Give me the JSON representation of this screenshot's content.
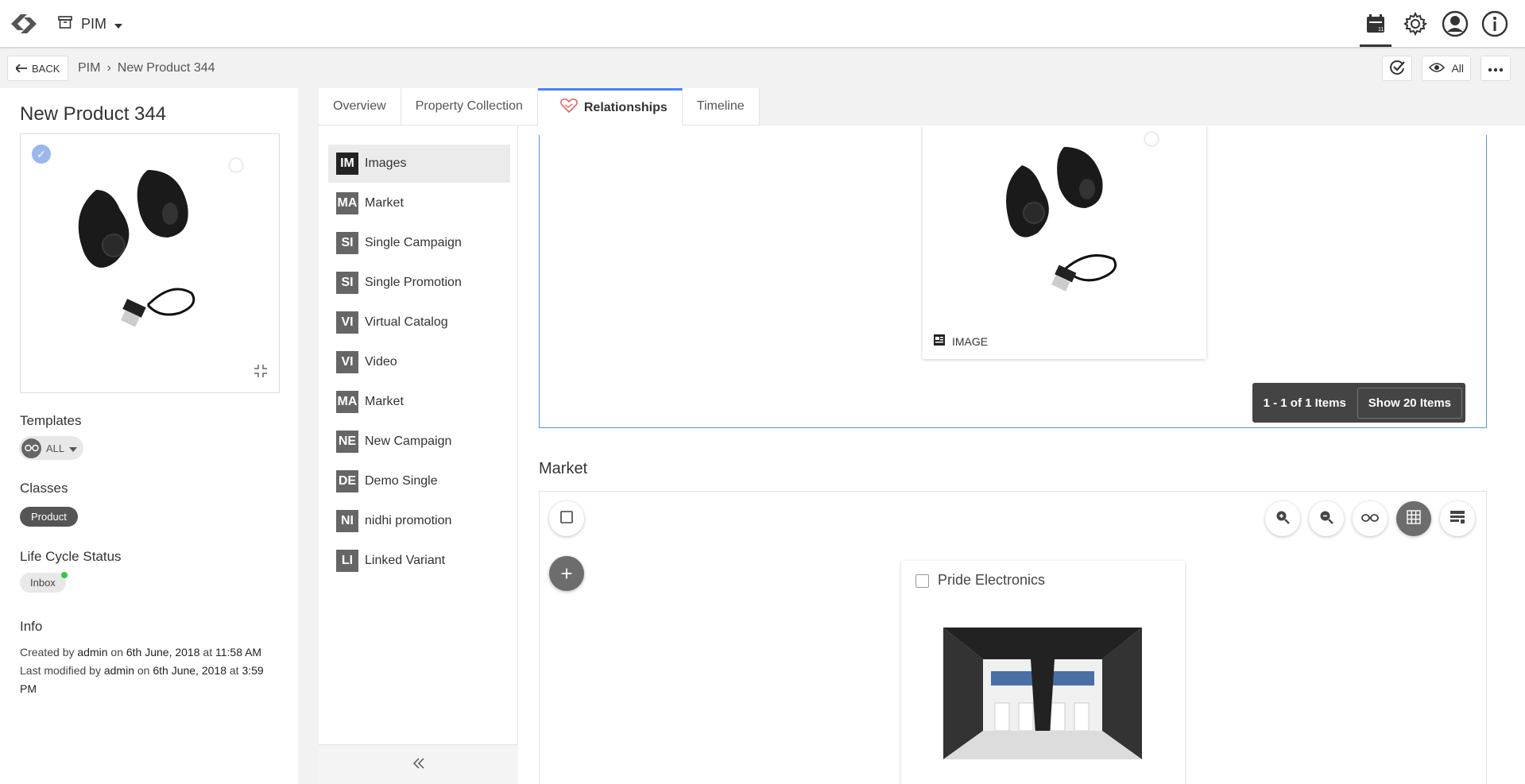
{
  "app": {
    "module": "PIM"
  },
  "subbar": {
    "back_label": "BACK",
    "breadcrumb": [
      "PIM",
      "New Product 344"
    ],
    "view_label": "All"
  },
  "product": {
    "title": "New Product 344",
    "templates_label": "Templates",
    "template_value": "ALL",
    "classes_label": "Classes",
    "class_value": "Product",
    "lifecycle_label": "Life Cycle Status",
    "lifecycle_value": "Inbox",
    "info_label": "Info",
    "created_prefix": "Created by",
    "created_by": "admin",
    "created_on_word": "on",
    "created_date": "6th June, 2018",
    "created_at_word": "at",
    "created_time": "11:58 AM",
    "modified_prefix": "Last modified by",
    "modified_by": "admin",
    "modified_on_word": "on",
    "modified_date": "6th June, 2018",
    "modified_at_word": "at",
    "modified_time": "3:59 PM"
  },
  "tabs": [
    "Overview",
    "Property Collection",
    "Relationships",
    "Timeline"
  ],
  "relationships": [
    {
      "code": "IM",
      "label": "Images"
    },
    {
      "code": "MA",
      "label": "Market"
    },
    {
      "code": "SI",
      "label": "Single Campaign"
    },
    {
      "code": "SI",
      "label": "Single Promotion"
    },
    {
      "code": "VI",
      "label": "Virtual Catalog"
    },
    {
      "code": "VI",
      "label": "Video"
    },
    {
      "code": "MA",
      "label": "Market"
    },
    {
      "code": "NE",
      "label": "New Campaign"
    },
    {
      "code": "DE",
      "label": "Demo Single"
    },
    {
      "code": "NI",
      "label": "nidhi promotion"
    },
    {
      "code": "LI",
      "label": "Linked Variant"
    }
  ],
  "images_section": {
    "card_type": "IMAGE",
    "pager_range": "1 - 1 of 1 Items",
    "pager_show": "Show 20 Items"
  },
  "market_section": {
    "title": "Market",
    "card_name": "Pride Electronics"
  },
  "colors": {
    "accent": "#4a86e8",
    "dark": "#444444"
  }
}
